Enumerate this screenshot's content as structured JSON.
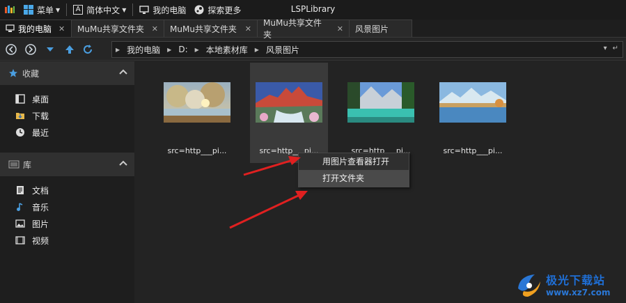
{
  "titlebar": {
    "menu_label": "菜单",
    "lang_label": "简体中文",
    "mypc_label": "我的电脑",
    "explore_label": "探索更多",
    "app_title": "LSPLibrary"
  },
  "tabs": [
    {
      "label": "我的电脑",
      "active": true
    },
    {
      "label": "MuMu共享文件夹",
      "active": false
    },
    {
      "label": "MuMu共享文件夹",
      "active": false
    },
    {
      "label": "MuMu共享文件夹",
      "active": false
    },
    {
      "label": "风景图片",
      "active": false
    }
  ],
  "breadcrumb": [
    "我的电脑",
    "D:",
    "本地素材库",
    "风景图片"
  ],
  "sidebar": {
    "favorites": {
      "title": "收藏",
      "items": [
        "桌面",
        "下载",
        "最近"
      ]
    },
    "library": {
      "title": "库",
      "items": [
        "文档",
        "音乐",
        "图片",
        "视频"
      ]
    }
  },
  "files": [
    {
      "label": "src=http___pi..."
    },
    {
      "label": "src=http___pi..."
    },
    {
      "label": "src=http___pi..."
    },
    {
      "label": "src=http___pi..."
    }
  ],
  "context_menu": {
    "open_viewer": "用图片查看器打开",
    "open_folder": "打开文件夹"
  },
  "watermark": {
    "name": "极光下载站",
    "url": "www.xz7.com"
  },
  "colors": {
    "annotation_arrow": "#e02020",
    "watermark_blue": "#1f6fd6",
    "accent_blue": "#4a9ee0"
  }
}
